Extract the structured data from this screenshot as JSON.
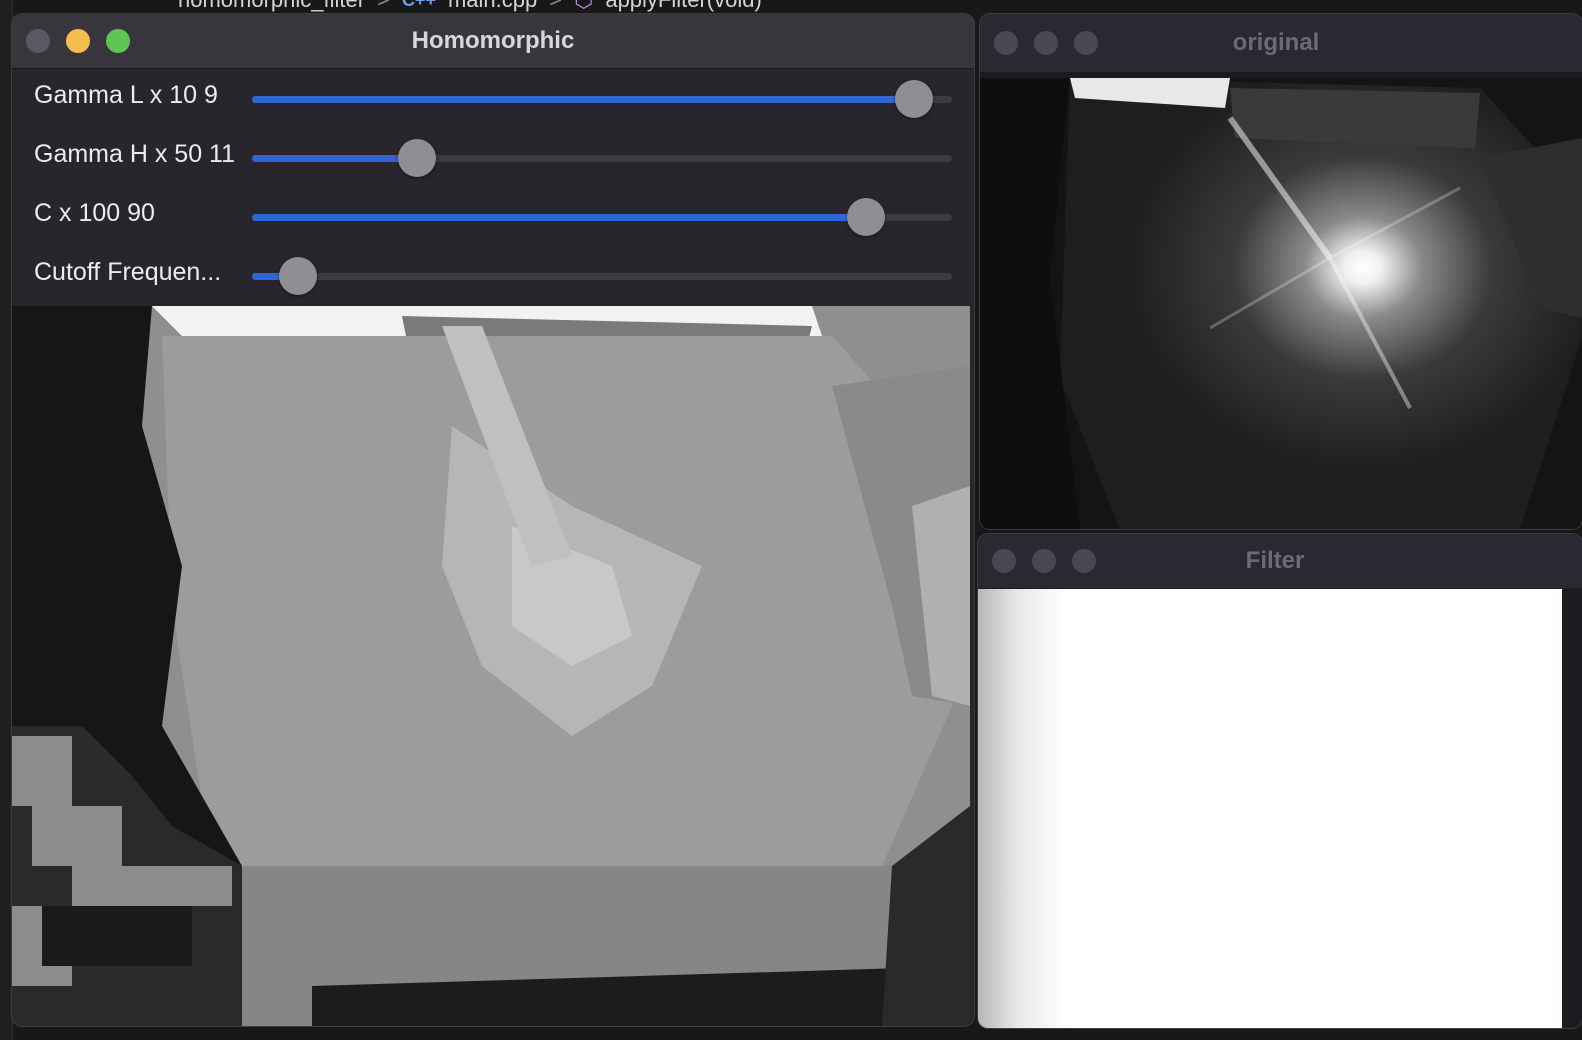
{
  "editor": {
    "breadcrumb": [
      "homomorphic_filter",
      "main.cpp",
      "applyFilter(void)"
    ],
    "separator": ">",
    "cpp_badge": "C++"
  },
  "homomorphic_window": {
    "title": "Homomorphic",
    "sliders": [
      {
        "label": "Gamma L x 10 9",
        "value_fraction": 0.945
      },
      {
        "label": "Gamma H x 50 11",
        "value_fraction": 0.236
      },
      {
        "label": "C x 100 90",
        "value_fraction": 0.877
      },
      {
        "label": "Cutoff Frequen...",
        "value_fraction": 0.065
      }
    ]
  },
  "original_window": {
    "title": "original"
  },
  "filter_window": {
    "title": "Filter"
  },
  "colors": {
    "slider_fill": "#2f67d8",
    "close": "#5a5860",
    "minimize": "#f5bd4f",
    "zoom": "#60c554"
  }
}
